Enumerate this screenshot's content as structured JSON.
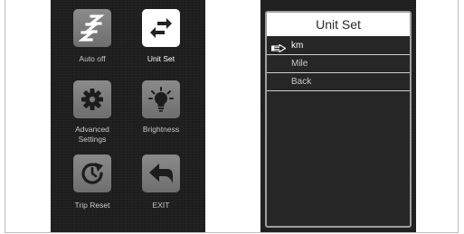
{
  "menu": {
    "items": [
      {
        "label": "Auto off",
        "icon": "sleep-zzz-icon",
        "selected": false
      },
      {
        "label": "Unit Set",
        "icon": "swap-arrows-icon",
        "selected": true
      },
      {
        "label_line1": "Advanced",
        "label_line2": "Settings",
        "icon": "gear-icon",
        "selected": false
      },
      {
        "label": "Brightness",
        "icon": "lightbulb-icon",
        "selected": false
      },
      {
        "label": "Trip Reset",
        "icon": "reset-arrow-icon",
        "selected": false
      },
      {
        "label": "EXIT",
        "icon": "back-arrow-icon",
        "selected": false
      }
    ]
  },
  "submenu": {
    "title": "Unit Set",
    "options": [
      {
        "label": "km",
        "selected": true
      },
      {
        "label": "Mile",
        "selected": false
      },
      {
        "label": "Back",
        "selected": false
      }
    ],
    "selection_pointer_icon": "pointing-hand-icon"
  },
  "colors": {
    "panel_bg": "#1f1f1f",
    "tile_grey": "#7a7a7a",
    "tile_active": "#ffffff",
    "text_dim": "#c9c9c9",
    "text_active": "#ffffff"
  }
}
